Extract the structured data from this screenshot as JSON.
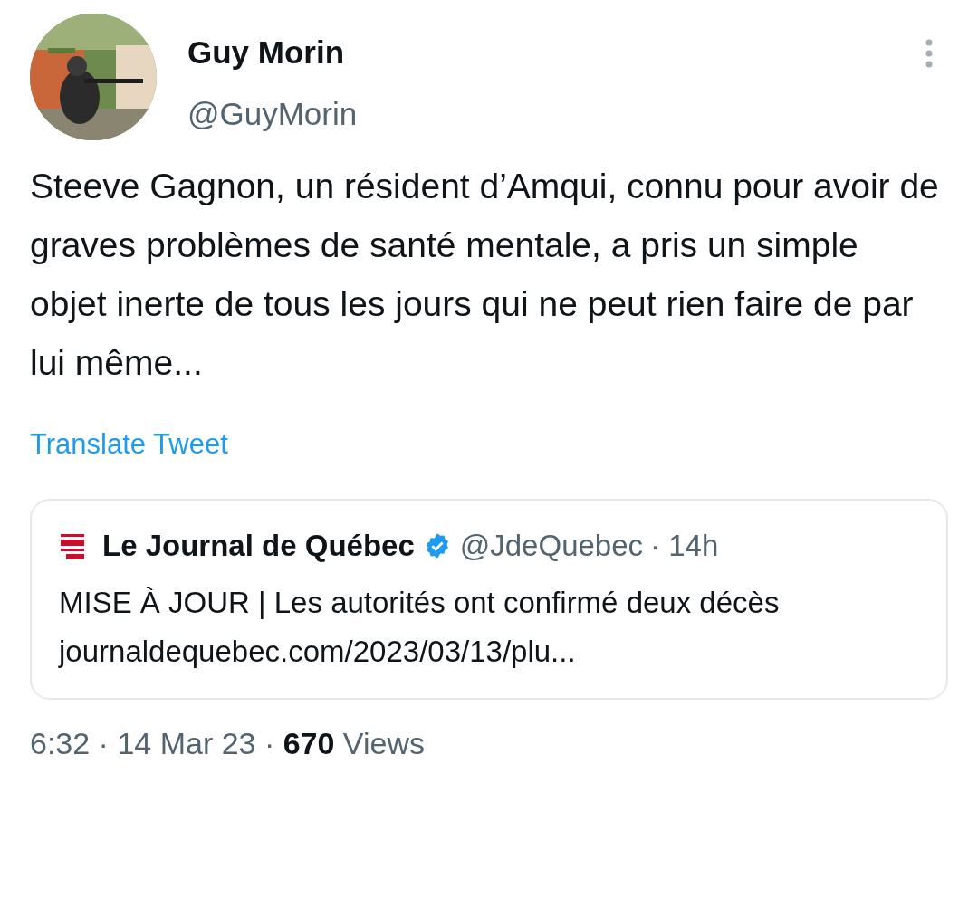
{
  "author": {
    "name": "Guy Morin",
    "handle": "@GuyMorin"
  },
  "tweet": {
    "text": "Steeve Gagnon, un résident d’Amqui, connu pour avoir de graves problèmes de santé mentale, a pris un simple objet inerte de tous les jours qui ne peut rien faire de par lui même...",
    "translate": "Translate Tweet"
  },
  "quote": {
    "name": "Le Journal de Québec",
    "verified": true,
    "handle": "@JdeQuebec",
    "time": "· 14h",
    "text": "MISE À JOUR | Les autorités ont confirmé deux décès",
    "link": "journaldequebec.com/2023/03/13/plu..."
  },
  "footer": {
    "meta": "6:32 · 14 Mar 23 · **670** Views"
  }
}
